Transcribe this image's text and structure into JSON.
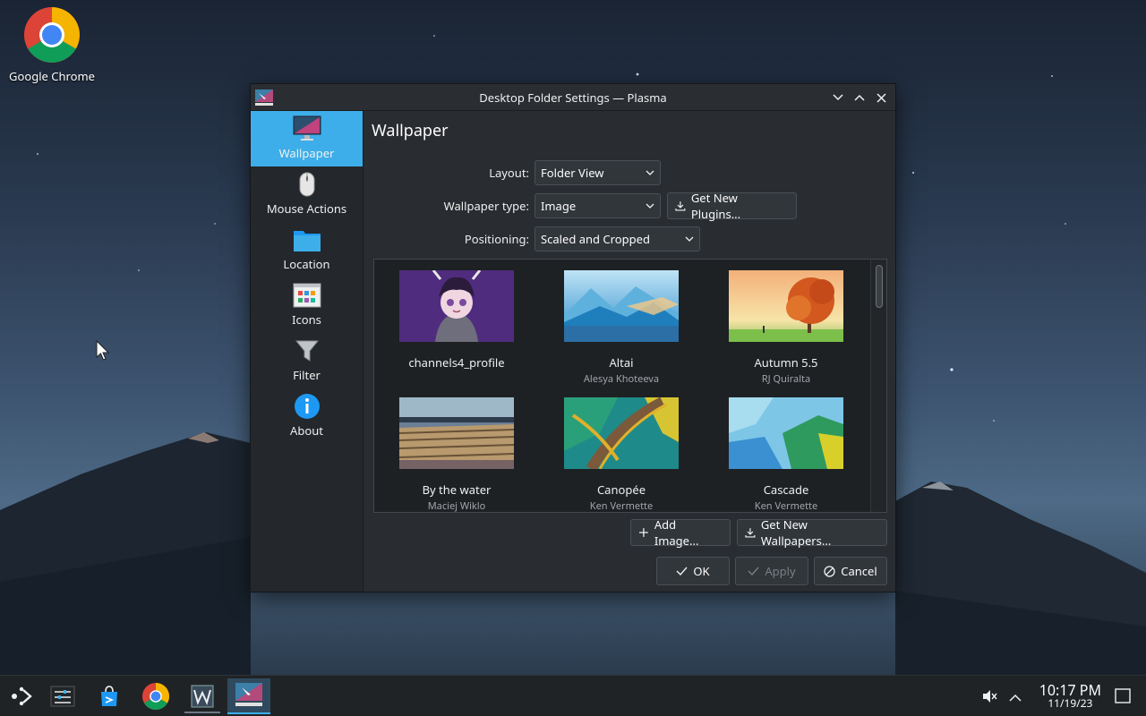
{
  "desktop": {
    "icons": [
      {
        "label": "Google Chrome",
        "icon": "chrome-icon"
      }
    ]
  },
  "window": {
    "title": "Desktop Folder Settings — Plasma",
    "controls": [
      "minimize",
      "maximize",
      "close"
    ]
  },
  "sidebar": {
    "items": [
      {
        "label": "Wallpaper",
        "icon": "monitor-icon",
        "active": true
      },
      {
        "label": "Mouse Actions",
        "icon": "mouse-icon",
        "active": false
      },
      {
        "label": "Location",
        "icon": "folder-icon",
        "active": false
      },
      {
        "label": "Icons",
        "icon": "icons-grid-icon",
        "active": false
      },
      {
        "label": "Filter",
        "icon": "filter-icon",
        "active": false
      },
      {
        "label": "About",
        "icon": "info-icon",
        "active": false
      }
    ]
  },
  "page": {
    "title": "Wallpaper",
    "layout_label": "Layout:",
    "layout_value": "Folder View",
    "wallpaper_type_label": "Wallpaper type:",
    "wallpaper_type_value": "Image",
    "get_plugins_label": "Get New Plugins...",
    "positioning_label": "Positioning:",
    "positioning_value": "Scaled and Cropped"
  },
  "wallpapers": [
    {
      "name": "channels4_profile",
      "author": ""
    },
    {
      "name": "Altai",
      "author": "Alesya Khoteeva"
    },
    {
      "name": "Autumn 5.5",
      "author": "RJ Quiralta"
    },
    {
      "name": "By the water",
      "author": "Maciej Wiklo"
    },
    {
      "name": "Canopée",
      "author": "Ken Vermette"
    },
    {
      "name": "Cascade",
      "author": "Ken Vermette"
    }
  ],
  "actions": {
    "add_image": "Add Image...",
    "get_wallpapers": "Get New Wallpapers...",
    "ok": "OK",
    "apply": "Apply",
    "cancel": "Cancel"
  },
  "taskbar": {
    "items": [
      "app-launcher-icon",
      "settings-sliders-icon",
      "store-icon",
      "chrome-icon",
      "text-editor-icon",
      "plasma-settings-icon"
    ],
    "clock_time": "10:17 PM",
    "clock_date": "11/19/23"
  },
  "colors": {
    "accent": "#3daee9",
    "window_bg": "#292c30",
    "sidebar_bg": "#24272b",
    "taskbar_bg": "#202326"
  }
}
